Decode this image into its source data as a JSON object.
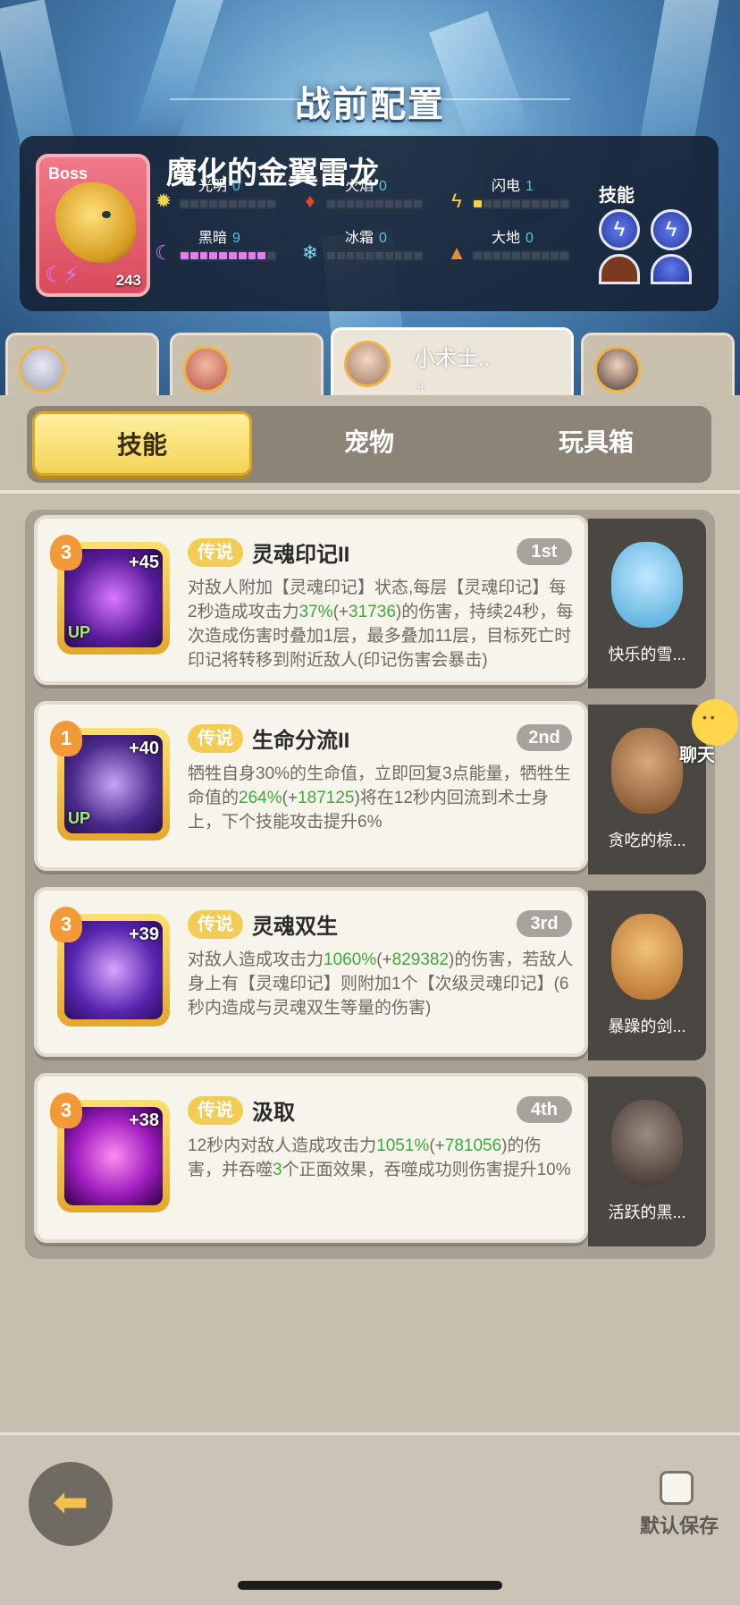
{
  "title": "战前配置",
  "boss": {
    "tag": "Boss",
    "name": "魔化的金翼雷龙",
    "level": "243",
    "elements": [
      {
        "label": "光明",
        "value": "0",
        "icon": "sun-icon"
      },
      {
        "label": "火焰",
        "value": "0",
        "icon": "flame-icon"
      },
      {
        "label": "闪电",
        "value": "1",
        "icon": "lightning-icon"
      },
      {
        "label": "黑暗",
        "value": "9",
        "icon": "moon-icon"
      },
      {
        "label": "冰霜",
        "value": "0",
        "icon": "snowflake-icon"
      },
      {
        "label": "大地",
        "value": "0",
        "icon": "earth-icon"
      }
    ],
    "skills_label": "技能"
  },
  "heroes": [
    {
      "name": ""
    },
    {
      "name": ""
    },
    {
      "name": "小术士..",
      "sub": "。",
      "active": true
    },
    {
      "name": ""
    }
  ],
  "tabs": {
    "skills": "技能",
    "pets": "宠物",
    "toybox": "玩具箱",
    "active": "技能"
  },
  "cards": [
    {
      "level": "3",
      "plus": "+45",
      "up": "UP",
      "rarity": "传说",
      "title": "灵魂印记II",
      "order": "1st",
      "desc": [
        "对敌人附加【灵魂印记】状态,每层【灵魂印记】每2秒造成攻击力",
        "37%",
        "(+",
        "31736",
        ")的伤害，持续24秒，每次造成伤害时叠加1层，最多叠加11层，目标死亡时印记将转移到附近敌人(印记伤害会暴击)"
      ],
      "pet": "快乐的雪..."
    },
    {
      "level": "1",
      "plus": "+40",
      "up": "UP",
      "rarity": "传说",
      "title": "生命分流II",
      "order": "2nd",
      "desc": [
        "牺牲自身30%的生命值，立即回复3点能量，牺牲生命值的",
        "264%",
        "(+",
        "187125",
        ")将在12秒内回流到术士身上，下个技能攻击提升6%"
      ],
      "pet": "贪吃的棕..."
    },
    {
      "level": "3",
      "plus": "+39",
      "up": "",
      "rarity": "传说",
      "title": "灵魂双生",
      "order": "3rd",
      "desc": [
        "对敌人造成攻击力",
        "1060%",
        "(+",
        "829382",
        ")的伤害，若敌人身上有【灵魂印记】则附加1个【次级灵魂印记】(6秒内造成与灵魂双生等量的伤害)"
      ],
      "pet": "暴躁的剑..."
    },
    {
      "level": "3",
      "plus": "+38",
      "up": "",
      "rarity": "传说",
      "title": "汲取",
      "order": "4th",
      "desc": [
        "12秒内对敌人造成攻击力",
        "1051%",
        "(+",
        "781056",
        ")的伤害，并吞噬",
        "3",
        "个正面效果，吞噬成功则伤害提升10%"
      ],
      "pet": "活跃的黑..."
    }
  ],
  "chat_label": "聊天",
  "save_label": "默认保存"
}
